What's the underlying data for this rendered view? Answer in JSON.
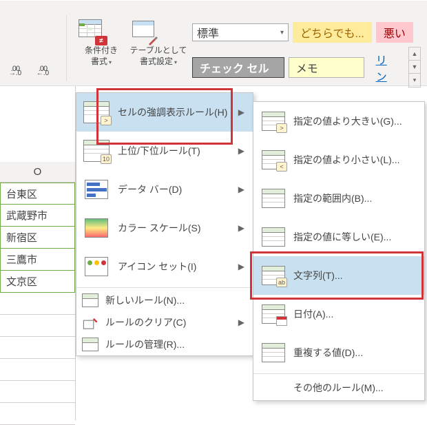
{
  "ribbon": {
    "decimal_increase": ".00",
    "decimal_increase_arrow": "→.0",
    "decimal_decrease": ".00",
    "decimal_decrease_arrow": "←.0",
    "conditional_format_label_1": "条件付き",
    "conditional_format_label_2": "書式",
    "table_format_label_1": "テーブルとして",
    "table_format_label_2": "書式設定",
    "style_dropdown": "標準",
    "chip_dochira": "どちらでも...",
    "chip_warui": "悪い",
    "chip_check": "チェック セル",
    "chip_memo": "メモ",
    "chip_link": "リン"
  },
  "sheet": {
    "col_header": "O",
    "cells": [
      "台東区",
      "武蔵野市",
      "新宿区",
      "三鷹市",
      "文京区"
    ]
  },
  "menu1": {
    "highlight_rules": "セルの強調表示ルール(H)",
    "top_bottom": "上位/下位ルール(T)",
    "data_bars": "データ バー(D)",
    "color_scales": "カラー スケール(S)",
    "icon_sets": "アイコン セット(I)",
    "new_rule": "新しいルール(N)...",
    "clear_rules": "ルールのクリア(C)",
    "manage_rules": "ルールの管理(R)..."
  },
  "menu2": {
    "greater": "指定の値より大きい(G)...",
    "less": "指定の値より小さい(L)...",
    "between": "指定の範囲内(B)...",
    "equal": "指定の値に等しい(E)...",
    "text": "文字列(T)...",
    "date": "日付(A)...",
    "duplicate": "重複する値(D)...",
    "more": "その他のルール(M)..."
  },
  "icons": {
    "ov_gt": ">",
    "ov_lt": "<",
    "ov_10": "10",
    "ov_ab": "ab"
  }
}
